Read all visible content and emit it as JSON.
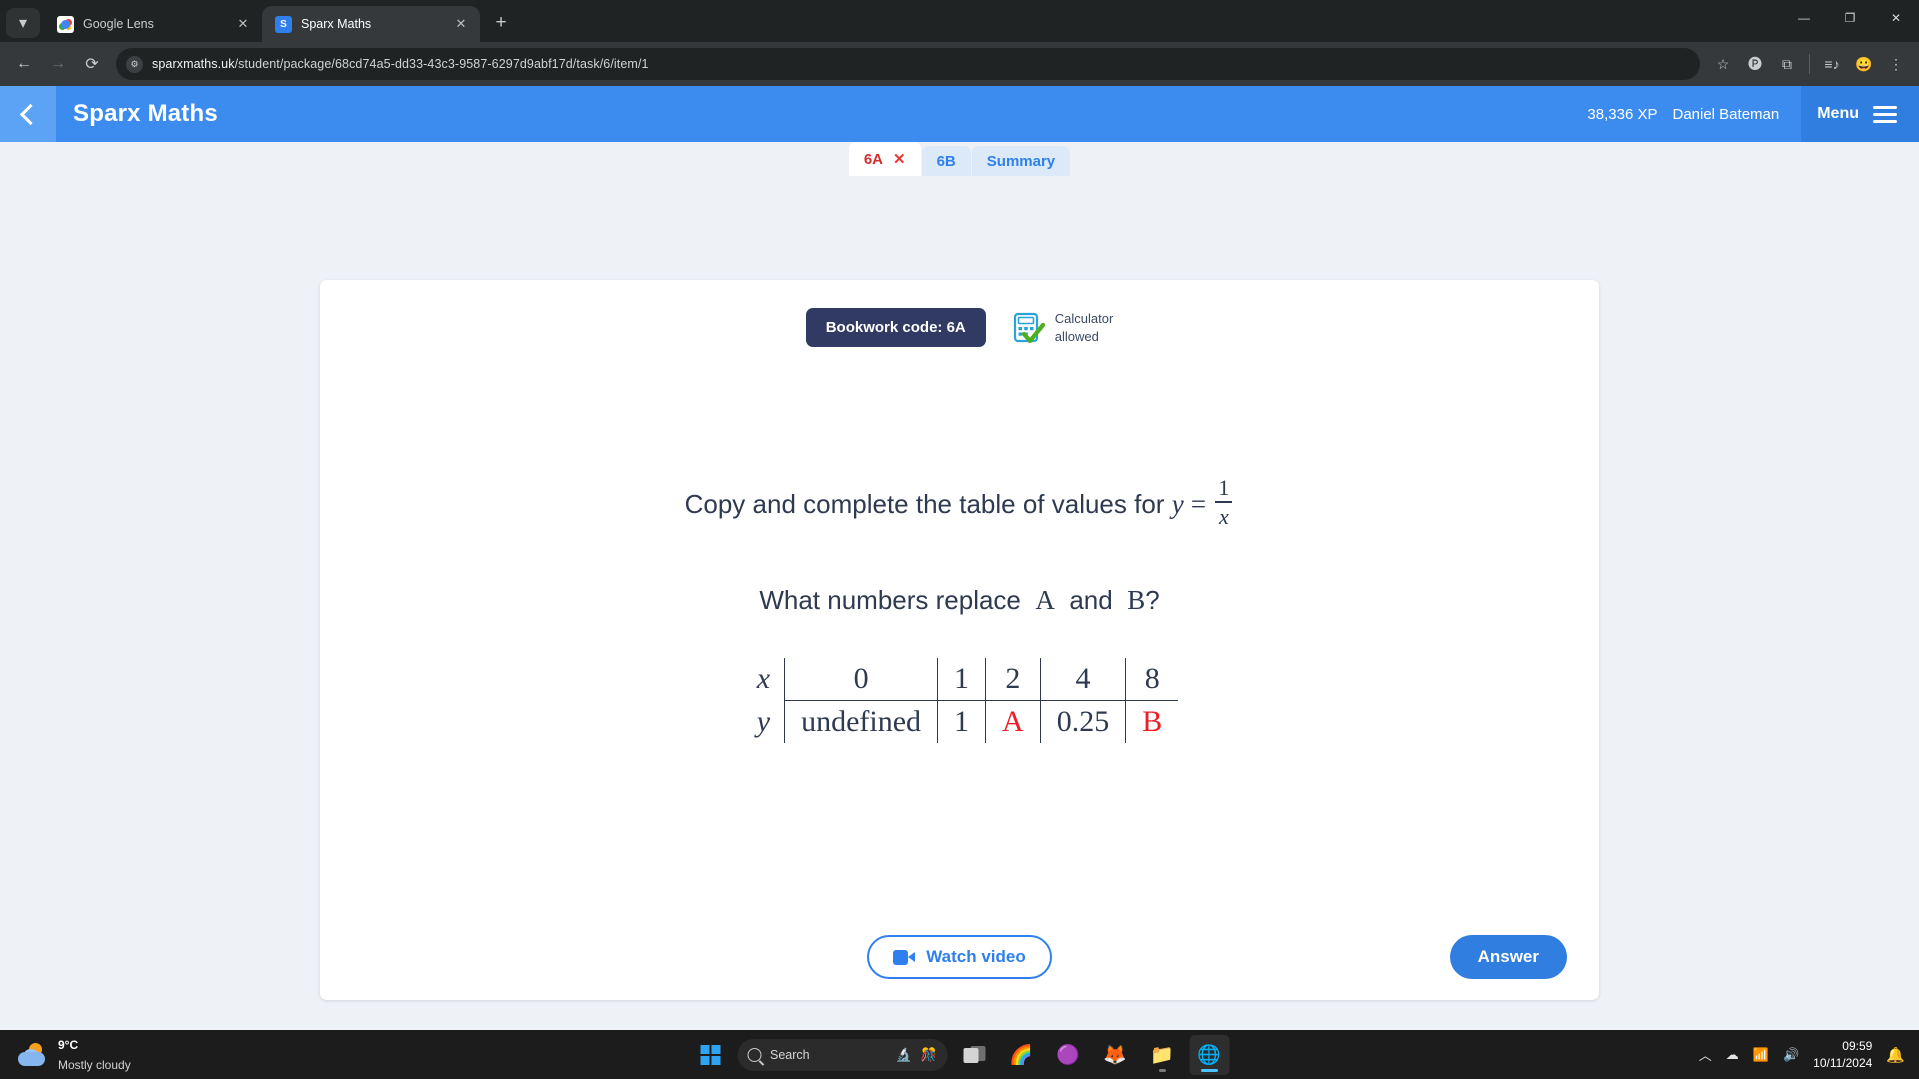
{
  "browser": {
    "tabs": [
      {
        "title": "Google Lens",
        "favicon": "google-lens-icon",
        "active": false
      },
      {
        "title": "Sparx Maths",
        "favicon": "sparx-icon",
        "active": true
      }
    ],
    "new_tab_label": "+",
    "window_controls": {
      "minimize": "—",
      "maximize": "❐",
      "close": "✕"
    },
    "nav": {
      "back": "←",
      "forward": "→",
      "reload": "⟳"
    },
    "url_host": "sparxmaths.uk",
    "url_path": "/student/package/68cd74a5-dd33-43c3-9587-6297d9abf17d/task/6/item/1",
    "toolbar_icons": [
      "bookmark-star-icon",
      "pinterest-icon",
      "extensions-icon",
      "media-playlist-icon",
      "profile-avatar-icon",
      "chrome-menu-icon"
    ]
  },
  "appbar": {
    "back_label": "back",
    "brand": "Sparx Maths",
    "xp": "38,336 XP",
    "user": "Daniel Bateman",
    "menu_label": "Menu"
  },
  "question_tabs": [
    {
      "label": "6A",
      "state": "active",
      "close": "✕"
    },
    {
      "label": "6B",
      "state": "idle"
    },
    {
      "label": "Summary",
      "state": "idle"
    }
  ],
  "card": {
    "bookwork_label": "Bookwork code: 6A",
    "calculator_line1": "Calculator",
    "calculator_line2": "allowed",
    "question_prefix": "Copy and complete the table of values for",
    "question_var_y": "y",
    "question_equals": "=",
    "fraction_numerator": "1",
    "fraction_denominator": "x",
    "question_line2_prefix": "What numbers replace",
    "question_line2_a": "A",
    "question_line2_mid": "and",
    "question_line2_b": "B",
    "question_line2_suffix": "?",
    "watch_video_label": "Watch video",
    "answer_label": "Answer"
  },
  "chart_data": {
    "type": "table",
    "title": "Table of values for y = 1/x",
    "row_labels": [
      "x",
      "y"
    ],
    "x": [
      "0",
      "1",
      "2",
      "4",
      "8"
    ],
    "y": [
      "undefined",
      "1",
      "A",
      "0.25",
      "B"
    ],
    "y_unknown_cells": [
      "A",
      "B"
    ],
    "unknown_color": "#ee1c25"
  },
  "taskbar": {
    "weather_temp": "9°C",
    "weather_desc": "Mostly cloudy",
    "search_placeholder": "Search",
    "apps": [
      "task-view-icon",
      "copilot-icon",
      "microsoft-teams-icon",
      "firefox-icon",
      "file-explorer-icon",
      "google-chrome-icon"
    ],
    "tray": [
      "show-hidden-icons-chevron",
      "onedrive-icon",
      "wifi-icon",
      "volume-icon"
    ],
    "time": "09:59",
    "date": "10/11/2024",
    "notification": "notification-bell-icon"
  },
  "colors": {
    "brand_blue": "#3c8cf0",
    "menu_blue": "#2f7ee0",
    "bookwork_navy": "#303a63",
    "unknown_red": "#ee1c25",
    "tab_red": "#d32f2f",
    "link_blue": "#2f80ed"
  }
}
